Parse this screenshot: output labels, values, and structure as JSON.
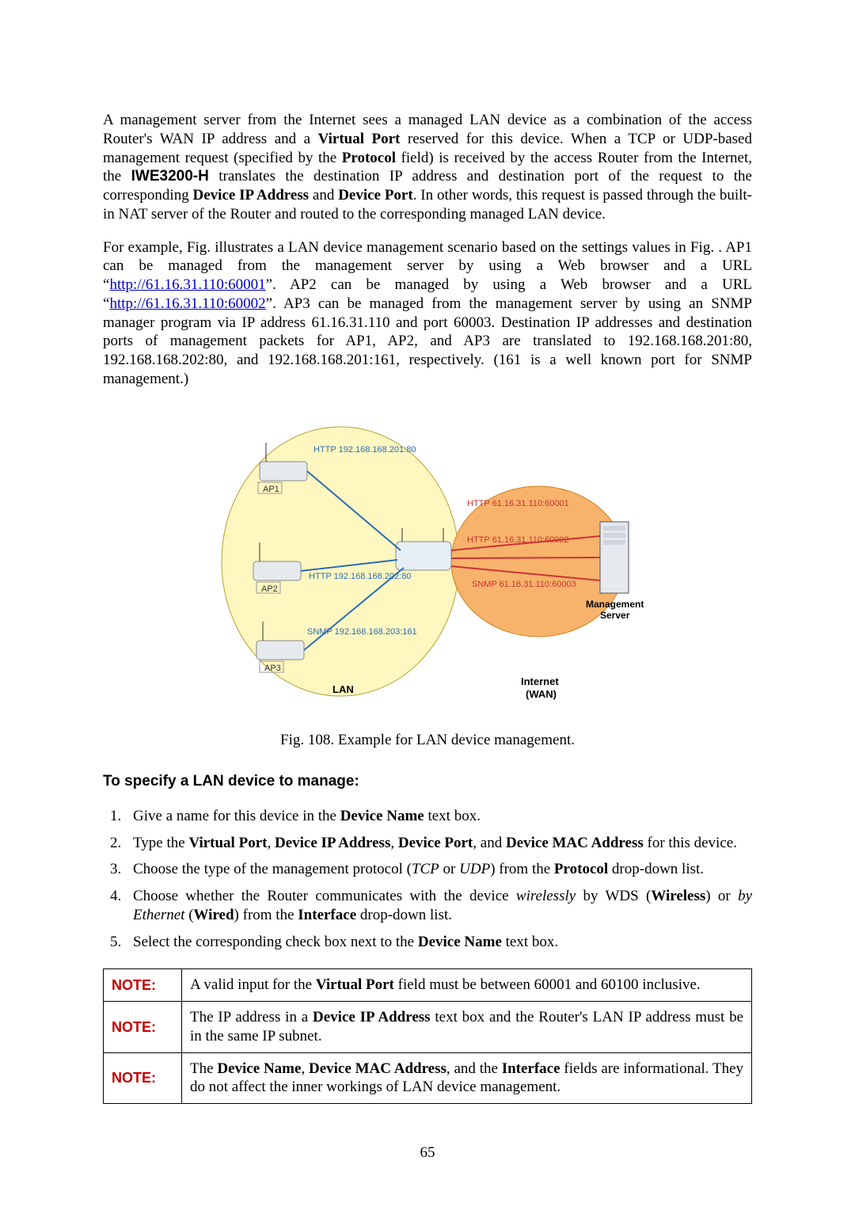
{
  "para1": {
    "t1": "A management server from the Internet sees a managed LAN device as a combination of the access Router's WAN IP address and a ",
    "b1": "Virtual Port",
    "t2": " reserved for this device. When a TCP or UDP-based management request (specified by the ",
    "b2": "Protocol",
    "t3": " field) is received by the access Router from the Internet, the ",
    "b3": "IWE3200-H",
    "t4": " translates the destination IP address and destination port of the request to the corresponding ",
    "b4": "Device IP Address",
    "t5": " and ",
    "b5": "Device Port",
    "t6": ". In other words, this request is passed through the built-in NAT server of the Router and routed to the corresponding managed LAN device."
  },
  "para2": {
    "t1": "For example, Fig.  illustrates a LAN device management scenario based on the settings values in Fig. . AP1 can be managed from the management server by using a Web browser and a URL “",
    "l1": "http://61.16.31.110:60001",
    "t2": "”. AP2 can be managed by using a Web browser and a URL “",
    "l2": "http://61.16.31.110:60002",
    "t3": "”. AP3 can be managed from the management server by using an SNMP manager program via IP address 61.16.31.110 and port 60003. Destination IP addresses and destination ports of management packets for AP1, AP2, and AP3 are translated to 192.168.168.201:80, 192.168.168.202:80, and 192.168.168.201:161, respectively. (161 is a well known port for SNMP management.)"
  },
  "figure": {
    "ap1_http": "HTTP 192.168.168.201:80",
    "ap1_label": "AP1",
    "ap2_http": "HTTP 192.168.168.202:80",
    "ap2_label": "AP2",
    "ap3_snmp": "SNMP 192.168.168.203:161",
    "ap3_label": "AP3",
    "wan_http1": "HTTP 61.16.31.110:60001",
    "wan_http2": "HTTP 61.16.31.110:60002",
    "wan_snmp": "SNMP 61.16.31.110:60003",
    "mgmt1": "Management",
    "mgmt2": "Server",
    "lan": "LAN",
    "inet1": "Internet",
    "inet2": "(WAN)"
  },
  "caption": "Fig. 108. Example for LAN device management.",
  "heading": "To specify a LAN device to manage:",
  "steps": {
    "s1a": "Give a name for this device in the ",
    "s1b": "Device Name",
    "s1c": " text box.",
    "s2a": "Type the ",
    "s2b": "Virtual Port",
    "s2c": ", ",
    "s2d": "Device IP Address",
    "s2e": ", ",
    "s2f": "Device Port",
    "s2g": ", and ",
    "s2h": "Device MAC Address",
    "s2i": " for this device.",
    "s3a": "Choose the type of the management protocol (",
    "s3b": "TCP",
    "s3c": " or ",
    "s3d": "UDP",
    "s3e": ") from the ",
    "s3f": "Protocol",
    "s3g": " drop-down list.",
    "s4a": "Choose whether the Router communicates with the device ",
    "s4b": "wirelessly",
    "s4c": " by WDS (",
    "s4d": "Wireless",
    "s4e": ") or ",
    "s4f": "by Ethernet",
    "s4g": " (",
    "s4h": "Wired",
    "s4i": ") from the ",
    "s4j": "Interface",
    "s4k": " drop-down list.",
    "s5a": "Select the corresponding check box next to the ",
    "s5b": "Device Name",
    "s5c": " text box."
  },
  "notes": {
    "label": "NOTE:",
    "n1a": "A valid input for the ",
    "n1b": "Virtual Port",
    "n1c": " field must be between 60001 and 60100 inclusive.",
    "n2a": "The IP address in a ",
    "n2b": "Device IP Address",
    "n2c": " text box and the Router's LAN IP address must be in the same IP subnet.",
    "n3a": "The ",
    "n3b": "Device Name",
    "n3c": ", ",
    "n3d": "Device MAC Address",
    "n3e": ", and the ",
    "n3f": "Interface",
    "n3g": " fields are informational. They do not affect the inner workings of LAN device management."
  },
  "pageno": "65"
}
